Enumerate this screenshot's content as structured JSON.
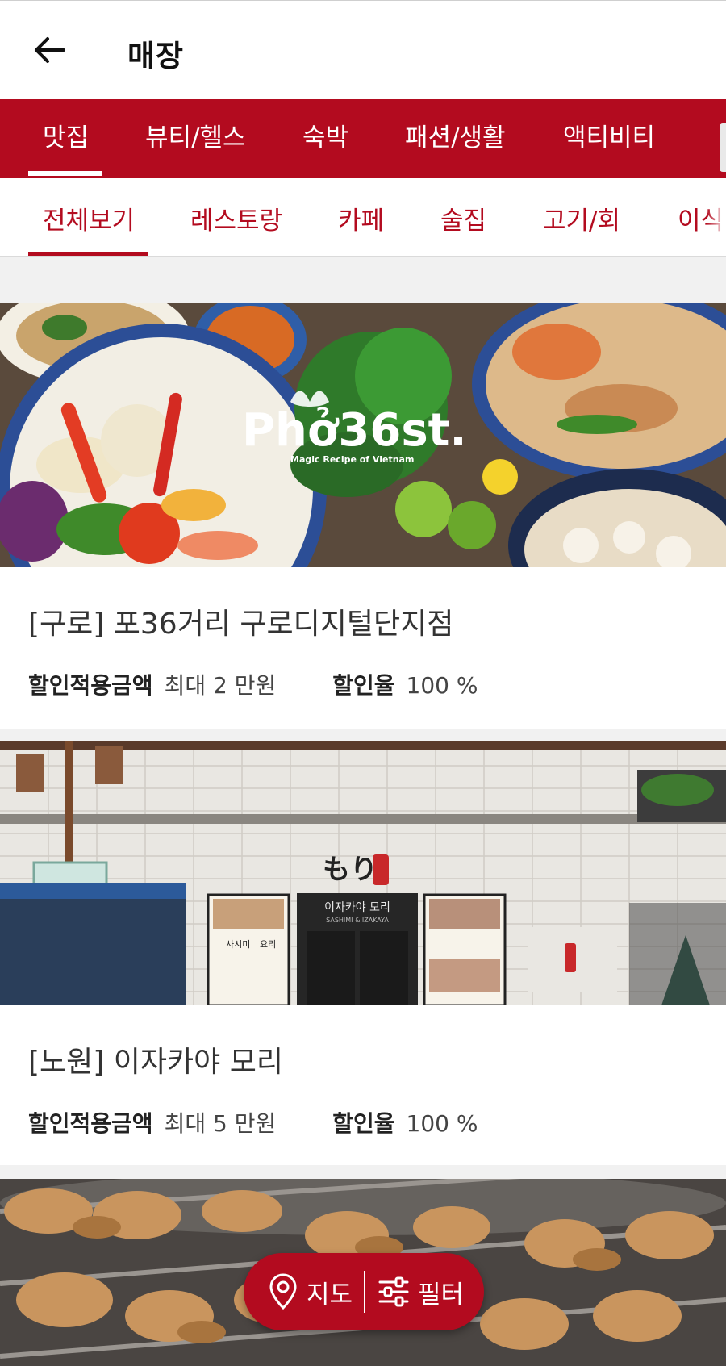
{
  "header": {
    "title": "매장"
  },
  "category_tabs": [
    {
      "label": "맛집",
      "active": true
    },
    {
      "label": "뷰티/헬스",
      "active": false
    },
    {
      "label": "숙박",
      "active": false
    },
    {
      "label": "패션/생활",
      "active": false
    },
    {
      "label": "액티비티",
      "active": false
    }
  ],
  "sub_tabs": [
    {
      "label": "전체보기",
      "active": true
    },
    {
      "label": "레스토랑",
      "active": false
    },
    {
      "label": "카페",
      "active": false
    },
    {
      "label": "술집",
      "active": false
    },
    {
      "label": "고기/회",
      "active": false
    },
    {
      "label": "이식",
      "active": false
    }
  ],
  "stores": [
    {
      "title": "[구로] 포36거리 구로디지털단지점",
      "discount_amount_label": "할인적용금액",
      "discount_amount_value": "최대 2 만원",
      "discount_rate_label": "할인율",
      "discount_rate_value": "100 %",
      "image": {
        "logo_text": "Phở36st.",
        "tagline": "Magic Recipe of Vietnam"
      }
    },
    {
      "title": "[노원] 이자카야 모리",
      "discount_amount_label": "할인적용금액",
      "discount_amount_value": "최대 5 만원",
      "discount_rate_label": "할인율",
      "discount_rate_value": "100 %",
      "image": {
        "sign_text": "もり",
        "door_sign": "이자카야 모리",
        "door_sign_sub": "SASHIMI & IZAKAYA",
        "menu_heading_1": "사시미",
        "menu_heading_2": "요리"
      }
    },
    {
      "title": "",
      "image": {}
    }
  ],
  "floating_bar": {
    "map_label": "지도",
    "filter_label": "필터"
  },
  "colors": {
    "brand_red": "#b30b1f",
    "white": "#ffffff"
  },
  "icons": {
    "back": "arrow-left-icon",
    "map": "map-pin-icon",
    "filter": "sliders-icon"
  }
}
